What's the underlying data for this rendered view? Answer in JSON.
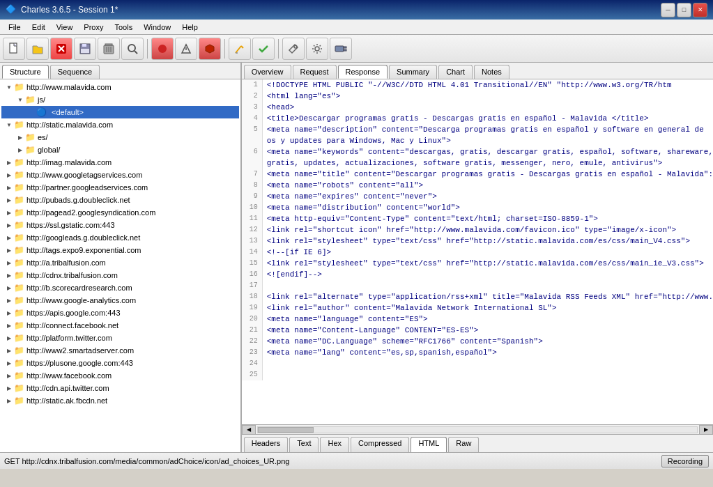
{
  "titleBar": {
    "title": "Charles 3.6.5 - Session 1*",
    "icon": "C",
    "minBtn": "─",
    "maxBtn": "□",
    "closeBtn": "✕"
  },
  "menuBar": {
    "items": [
      "File",
      "Edit",
      "View",
      "Proxy",
      "Tools",
      "Window",
      "Help"
    ]
  },
  "toolbar": {
    "buttons": [
      {
        "name": "new",
        "icon": "📄"
      },
      {
        "name": "open",
        "icon": "📂"
      },
      {
        "name": "delete",
        "icon": "🗑"
      },
      {
        "name": "save",
        "icon": "💾"
      },
      {
        "name": "trash",
        "icon": "🗑"
      },
      {
        "name": "search",
        "icon": "🔍"
      },
      {
        "name": "record",
        "icon": "⏺"
      },
      {
        "name": "filter",
        "icon": "⚡"
      },
      {
        "name": "stop",
        "icon": "⬡"
      },
      {
        "name": "edit",
        "icon": "✏"
      },
      {
        "name": "check",
        "icon": "✓"
      },
      {
        "name": "tools",
        "icon": "🔧"
      },
      {
        "name": "settings",
        "icon": "⚙"
      },
      {
        "name": "plugin",
        "icon": "🔌"
      }
    ]
  },
  "leftPanel": {
    "tabs": [
      "Structure",
      "Sequence"
    ],
    "activeTab": "Structure",
    "treeItems": [
      {
        "id": 1,
        "label": "http://www.malavida.com",
        "indent": 1,
        "expanded": true,
        "type": "folder"
      },
      {
        "id": 2,
        "label": "js/",
        "indent": 2,
        "expanded": true,
        "type": "folder"
      },
      {
        "id": 3,
        "label": "<default>",
        "indent": 3,
        "expanded": false,
        "type": "default",
        "selected": true
      },
      {
        "id": 4,
        "label": "http://static.malavida.com",
        "indent": 1,
        "expanded": true,
        "type": "folder"
      },
      {
        "id": 5,
        "label": "es/",
        "indent": 2,
        "expanded": false,
        "type": "folder"
      },
      {
        "id": 6,
        "label": "global/",
        "indent": 2,
        "expanded": false,
        "type": "folder"
      },
      {
        "id": 7,
        "label": "http://imag.malavida.com",
        "indent": 1,
        "expanded": false,
        "type": "folder"
      },
      {
        "id": 8,
        "label": "http://www.googletagservices.com",
        "indent": 1,
        "expanded": false,
        "type": "folder"
      },
      {
        "id": 9,
        "label": "http://partner.googleadservices.com",
        "indent": 1,
        "expanded": false,
        "type": "folder"
      },
      {
        "id": 10,
        "label": "http://pubads.g.doubleclick.net",
        "indent": 1,
        "expanded": false,
        "type": "folder"
      },
      {
        "id": 11,
        "label": "http://pagead2.googlesyndication.com",
        "indent": 1,
        "expanded": false,
        "type": "folder"
      },
      {
        "id": 12,
        "label": "https://ssl.gstatic.com:443",
        "indent": 1,
        "expanded": false,
        "type": "folder"
      },
      {
        "id": 13,
        "label": "http://googleads.g.doubleclick.net",
        "indent": 1,
        "expanded": false,
        "type": "folder"
      },
      {
        "id": 14,
        "label": "http://tags.expo9.exponential.com",
        "indent": 1,
        "expanded": false,
        "type": "folder"
      },
      {
        "id": 15,
        "label": "http://a.tribalfusion.com",
        "indent": 1,
        "expanded": false,
        "type": "folder"
      },
      {
        "id": 16,
        "label": "http://cdnx.tribalfusion.com",
        "indent": 1,
        "expanded": false,
        "type": "folder"
      },
      {
        "id": 17,
        "label": "http://b.scorecardresearch.com",
        "indent": 1,
        "expanded": false,
        "type": "folder"
      },
      {
        "id": 18,
        "label": "http://www.google-analytics.com",
        "indent": 1,
        "expanded": false,
        "type": "folder"
      },
      {
        "id": 19,
        "label": "https://apis.google.com:443",
        "indent": 1,
        "expanded": false,
        "type": "folder"
      },
      {
        "id": 20,
        "label": "http://connect.facebook.net",
        "indent": 1,
        "expanded": false,
        "type": "folder"
      },
      {
        "id": 21,
        "label": "http://platform.twitter.com",
        "indent": 1,
        "expanded": false,
        "type": "folder"
      },
      {
        "id": 22,
        "label": "http://www2.smartadserver.com",
        "indent": 1,
        "expanded": false,
        "type": "folder"
      },
      {
        "id": 23,
        "label": "https://plusone.google.com:443",
        "indent": 1,
        "expanded": false,
        "type": "folder"
      },
      {
        "id": 24,
        "label": "http://www.facebook.com",
        "indent": 1,
        "expanded": false,
        "type": "folder"
      },
      {
        "id": 25,
        "label": "http://cdn.api.twitter.com",
        "indent": 1,
        "expanded": false,
        "type": "folder"
      },
      {
        "id": 26,
        "label": "http://static.ak.fbcdn.net",
        "indent": 1,
        "expanded": false,
        "type": "folder"
      }
    ]
  },
  "rightPanel": {
    "tabs": [
      "Overview",
      "Request",
      "Response",
      "Summary",
      "Chart",
      "Notes"
    ],
    "activeTab": "Response",
    "codeLines": [
      {
        "num": 1,
        "content": "<!DOCTYPE HTML PUBLIC \"-//W3C//DTD HTML 4.01 Transitional//EN\" \"http://www.w3.org/TR/htm"
      },
      {
        "num": 2,
        "content": "<html lang=\"es\">"
      },
      {
        "num": 3,
        "content": "<head>"
      },
      {
        "num": 4,
        "content": "  <title>Descargar programas gratis - Descargas gratis en español - Malavida </title>"
      },
      {
        "num": 5,
        "content": "  <meta name=\"description\" content=\"Descarga programas gratis en español y software en general de"
      },
      {
        "num": 5,
        "content": "  os y updates para Windows, Mac y Linux\">"
      },
      {
        "num": 6,
        "content": "  <meta name=\"keywords\" content=\"descargas, gratis, descargar gratis, español, software, shareware,"
      },
      {
        "num": 6,
        "content": "  gratis, updates, actualizaciones, software gratis, messenger, nero, emule, antivirus\">"
      },
      {
        "num": 7,
        "content": "  <meta name=\"title\" content=\"Descargar programas gratis - Descargas gratis en español - Malavida\":"
      },
      {
        "num": 8,
        "content": "  <meta name=\"robots\" content=\"all\">"
      },
      {
        "num": 9,
        "content": "  <meta name=\"expires\" content=\"never\">"
      },
      {
        "num": 10,
        "content": "  <meta name=\"distribution\" content=\"world\">"
      },
      {
        "num": 11,
        "content": "  <meta http-equiv=\"Content-Type\" content=\"text/html; charset=ISO-8859-1\">"
      },
      {
        "num": 12,
        "content": "  <link rel=\"shortcut icon\" href=\"http://www.malavida.com/favicon.ico\" type=\"image/x-icon\">"
      },
      {
        "num": 13,
        "content": "  <link rel=\"stylesheet\" type=\"text/css\" href=\"http://static.malavida.com/es/css/main_V4.css\">"
      },
      {
        "num": 14,
        "content": "  <!--[if IE 6]>"
      },
      {
        "num": 15,
        "content": "  <link rel=\"stylesheet\" type=\"text/css\" href=\"http://static.malavida.com/es/css/main_ie_V3.css\">"
      },
      {
        "num": 16,
        "content": "  <![endif]-->"
      },
      {
        "num": 17,
        "content": ""
      },
      {
        "num": 18,
        "content": "  <link rel=\"alternate\" type=\"application/rss+xml\" title=\"Malavida RSS Feeds XML\" href=\"http://www."
      },
      {
        "num": 19,
        "content": "  <link rel=\"author\" content=\"Malavida Network International SL\">"
      },
      {
        "num": 20,
        "content": "  <meta name=\"language\" content=\"ES\">"
      },
      {
        "num": 21,
        "content": "  <meta name=\"Content-Language\" CONTENT=\"ES-ES\">"
      },
      {
        "num": 22,
        "content": "  <meta name=\"DC.Language\" scheme=\"RFC1766\" content=\"Spanish\">"
      },
      {
        "num": 23,
        "content": "  <meta name=\"lang\" content=\"es,sp,spanish,español\">"
      },
      {
        "num": 24,
        "content": ""
      },
      {
        "num": 25,
        "content": ""
      }
    ],
    "bottomTabs": [
      "Headers",
      "Text",
      "Hex",
      "Compressed",
      "HTML",
      "Raw"
    ],
    "activeBottomTab": "HTML"
  },
  "statusBar": {
    "text": "GET http://cdnx.tribalfusion.com/media/common/adChoice/icon/ad_choices_UR.png",
    "recordingLabel": "Recording"
  }
}
